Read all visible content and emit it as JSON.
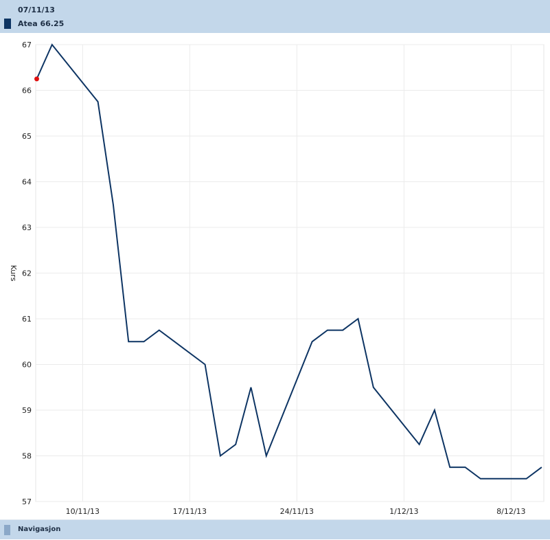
{
  "header": {
    "date": "07/11/13",
    "legend": "Atea 66.25",
    "series_color": "#0d3463"
  },
  "footer": {
    "navigation_label": "Navigasjon"
  },
  "chart_data": {
    "type": "line",
    "title": "",
    "xlabel": "",
    "ylabel": "Kurs",
    "ylim": [
      57,
      67
    ],
    "yticks": [
      "57",
      "58",
      "59",
      "60",
      "61",
      "62",
      "63",
      "64",
      "65",
      "66",
      "67"
    ],
    "xticks": [
      "10/11/13",
      "17/11/13",
      "24/11/13",
      "1/12/13",
      "8/12/13"
    ],
    "grid": true,
    "series": [
      {
        "name": "Atea",
        "color": "#0d3463",
        "x": [
          "07/11/13",
          "08/11/13",
          "11/11/13",
          "12/11/13",
          "13/11/13",
          "14/11/13",
          "15/11/13",
          "18/11/13",
          "19/11/13",
          "20/11/13",
          "21/11/13",
          "22/11/13",
          "25/11/13",
          "26/11/13",
          "27/11/13",
          "28/11/13",
          "29/11/13",
          "02/12/13",
          "03/12/13",
          "04/12/13",
          "05/12/13",
          "06/12/13",
          "09/12/13",
          "10/12/13"
        ],
        "values": [
          66.25,
          67,
          65.75,
          63.5,
          60.5,
          60.5,
          60.75,
          60,
          58,
          58.25,
          59.5,
          58,
          60.5,
          60.75,
          60.75,
          61,
          59.5,
          58.25,
          59,
          57.75,
          57.75,
          57.5,
          57.5,
          57.75
        ]
      }
    ],
    "highlight": {
      "x": "07/11/13",
      "value": 66.25,
      "color": "#e01010"
    }
  }
}
